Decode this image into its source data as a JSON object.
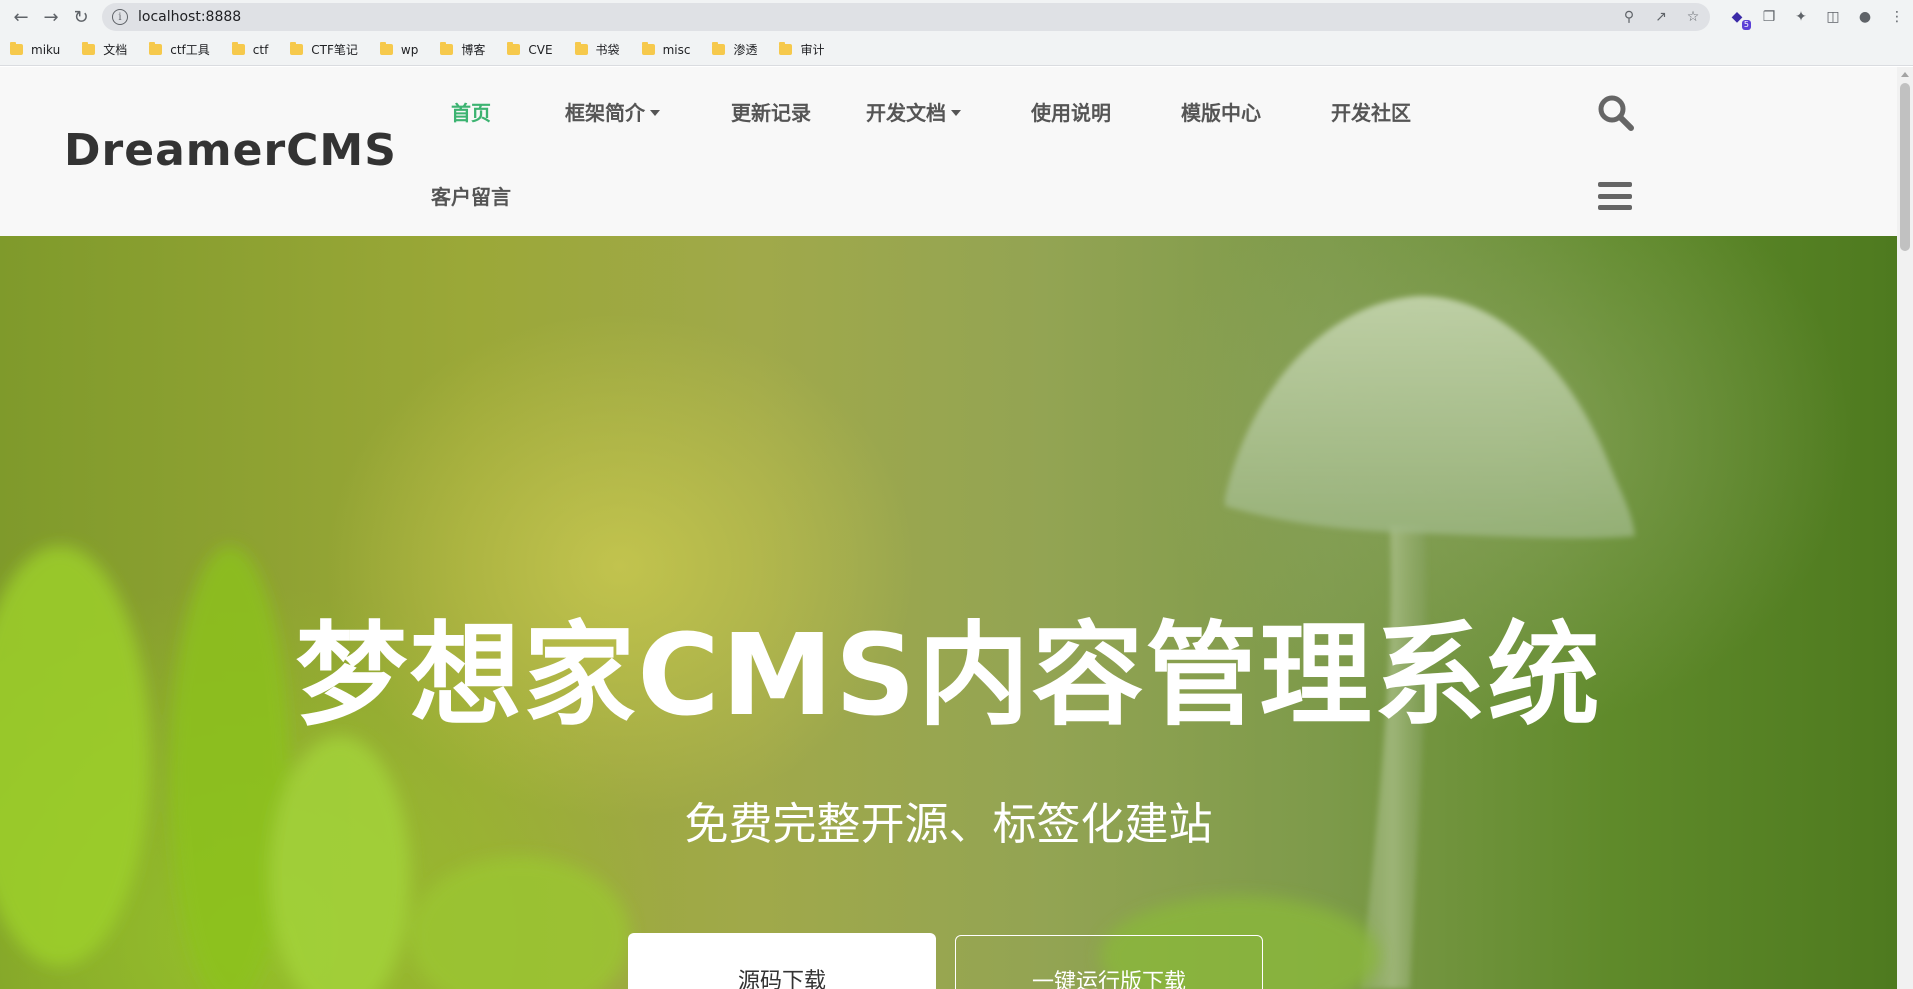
{
  "browser": {
    "url": "localhost:8888",
    "extension_badge": "5",
    "bookmarks": [
      "miku",
      "文档",
      "ctf工具",
      "ctf",
      "CTF笔记",
      "wp",
      "博客",
      "CVE",
      "书袋",
      "misc",
      "渗透",
      "审计"
    ]
  },
  "header": {
    "logo": "DreamerCMS",
    "nav": [
      {
        "label": "首页",
        "active": true
      },
      {
        "label": "框架简介",
        "dropdown": true
      },
      {
        "label": "更新记录"
      },
      {
        "label": "开发文档",
        "dropdown": true
      },
      {
        "label": "使用说明"
      },
      {
        "label": "模版中心"
      },
      {
        "label": "开发社区"
      },
      {
        "label": "客户留言"
      }
    ],
    "accent_color": "#3cb371"
  },
  "hero": {
    "title": "梦想家CMS内容管理系统",
    "subtitle": "免费完整开源、标签化建站",
    "primary_button": "源码下载",
    "secondary_button": "一键运行版下载"
  }
}
